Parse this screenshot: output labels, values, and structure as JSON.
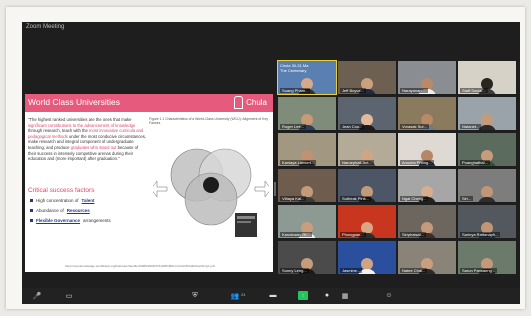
{
  "window": {
    "title": "Zoom Meeting"
  },
  "slide": {
    "title": "World Class Universities",
    "brand": "Chula",
    "quote_plain_1": "\"The highest ranked universities are the ones that make ",
    "quote_hl_1": "significant contributions to the advancement of knowledge",
    "quote_plain_2": " through research, teach with the ",
    "quote_hl_2": "most innovative curricula and pedagogical methods",
    "quote_plain_3": " under the most conducive circumstances, make research and integral component of undergraduate teaching, and produce ",
    "quote_hl_3": "graduates who stand out",
    "quote_plain_4": " because of their success in intensely competitive arenas during their education and (more important) after graduation.\"",
    "figure_caption": "Figure 1.1   Characteristics of a World-Class University (WCU): Alignment of Key Factors",
    "csf_title": "Critical success factors",
    "csf_items": [
      {
        "prefix": "High concentration of ",
        "highlight": "Talent",
        "suffix": ""
      },
      {
        "prefix": "Abundance of ",
        "highlight": "Resources",
        "suffix": ""
      },
      {
        "prefix": "",
        "highlight": "Flexible Governance",
        "suffix": " arrangements"
      }
    ],
    "source": "https://openknowledge.worldbank.org/bitstream/handle/10986/2600/476100PUB0Univ101Official0Use0Only1.pdf"
  },
  "participants": [
    {
      "name": "Suang Pham...",
      "bg": "#5a7fb1",
      "head": "#d6a98a",
      "torso": "#2f2f2f",
      "active": true,
      "banner": "Chula 30-31 Ma\nThe Centenary"
    },
    {
      "name": "Jeff Boyce...",
      "bg": "#6d6052",
      "head": "#caa07d",
      "torso": "#1f2a44"
    },
    {
      "name": "Narayanan ...",
      "bg": "#8a8d92",
      "head": "#b98a6a",
      "torso": "#f0f0f0"
    },
    {
      "name": "Staff Social...",
      "bg": "#d7d2c8",
      "head": "#2b2520",
      "torso": "#3c3c3c"
    },
    {
      "name": "Roger Lee...",
      "bg": "#7f8c7a",
      "head": "#c79a78",
      "torso": "#274060"
    },
    {
      "name": "Jean Coo...",
      "bg": "#5c6470",
      "head": "#e2b99a",
      "torso": "#1b1b1b"
    },
    {
      "name": "Vorasak Sur...",
      "bg": "#8a7a5e",
      "head": "#b88a66",
      "torso": "#6b7b8c"
    },
    {
      "name": "Natanet...",
      "bg": "#9aa3aa",
      "head": "#c49b7a",
      "torso": "#2a2a2a"
    },
    {
      "name": "Kanlaya Lamlert...",
      "bg": "#a29780",
      "head": "#c09172",
      "torso": "#2e2e2e"
    },
    {
      "name": "Naruephak Ant...",
      "bg": "#b3aa98",
      "head": "#d0a586",
      "torso": "#585858"
    },
    {
      "name": "Anucha Phong...",
      "bg": "#dedad3",
      "head": "#b58767",
      "torso": "#2b3a5a"
    },
    {
      "name": "Puanghathai...",
      "bg": "#5b6b5d",
      "head": "#c69c7d",
      "torso": "#30503b"
    },
    {
      "name": "Vittaya Kal...",
      "bg": "#6e5d4f",
      "head": "#c49b7a",
      "torso": "#3b3b3b"
    },
    {
      "name": "Suthirak Pinit...",
      "bg": "#4c5666",
      "head": "#c49b7a",
      "torso": "#1f1f1f"
    },
    {
      "name": "Ngai Cheng...",
      "bg": "#a6a6a6",
      "head": "#d6ad8f",
      "torso": "#222222"
    },
    {
      "name": "Siri...",
      "bg": "#7d7d7d",
      "head": "#c19676",
      "torso": "#2e2e2e"
    },
    {
      "name": "Kanokwan Th...",
      "bg": "#8d9993",
      "head": "#c99e7f",
      "torso": "#f0f0f0"
    },
    {
      "name": "Phongpan...",
      "bg": "#c9361f",
      "head": "#d8a785",
      "torso": "#2d2d2d"
    },
    {
      "name": "Siriphaisal...",
      "bg": "#6d665e",
      "head": "#c39b7b",
      "torso": "#3a2f2a"
    },
    {
      "name": "Sarinya Rattanaph...",
      "bg": "#52585e",
      "head": "#c09676",
      "torso": "#1f3550"
    },
    {
      "name": "Sunny Leng...",
      "bg": "#4b4b4b",
      "head": "#c59c7c",
      "torso": "#1a1a1a"
    },
    {
      "name": "Jasmine...",
      "bg": "#2a4f9c",
      "head": "#cfa383",
      "torso": "#f1f1f1"
    },
    {
      "name": "Natee Chai...",
      "bg": "#8a8378",
      "head": "#c8a080",
      "torso": "#2b2b2b"
    },
    {
      "name": "Sarun Pansaeng...",
      "bg": "#6b7a6b",
      "head": "#c29a7a",
      "torso": "#2c2c2c"
    }
  ],
  "toolbar": {
    "participant_count": "24"
  },
  "colors": {
    "accent": "#e65a7d",
    "frame": "#f7f6f3",
    "screen": "#1e1e1e"
  }
}
